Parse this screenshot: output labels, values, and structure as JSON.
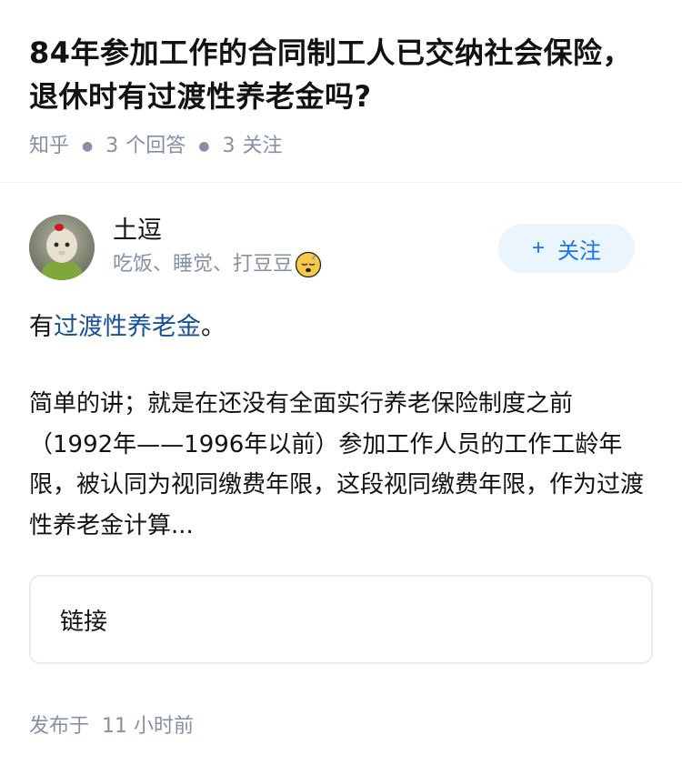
{
  "question": {
    "title": "84年参加工作的合同制工人已交纳社会保险，退休时有过渡性养老金吗?",
    "source": "知乎",
    "answers_count": "3",
    "answers_label": "个回答",
    "follows_count": "3",
    "follows_label": "关注"
  },
  "answer": {
    "author_name": "土逗",
    "author_bio": "吃饭、睡觉、打豆豆",
    "bio_emoji_icon": "sleeping-face-icon",
    "follow_button": "关注",
    "lead_prefix": "有",
    "lead_link": "过渡性养老金",
    "lead_suffix": "。",
    "excerpt": "简单的讲；就是在还没有全面实行养老保险制度之前（1992年——1996年以前）参加工作人员的工作工龄年限，被认同为视同缴费年限，这段视同缴费年限，作为过渡性养老金计算...",
    "link_card_label": "链接",
    "published_label": "发布于",
    "published_time": "11 小时前"
  },
  "colors": {
    "link": "#175199",
    "meta": "#8590a6",
    "follow_bg": "#ebf5fd",
    "follow_text": "#1772f6"
  }
}
